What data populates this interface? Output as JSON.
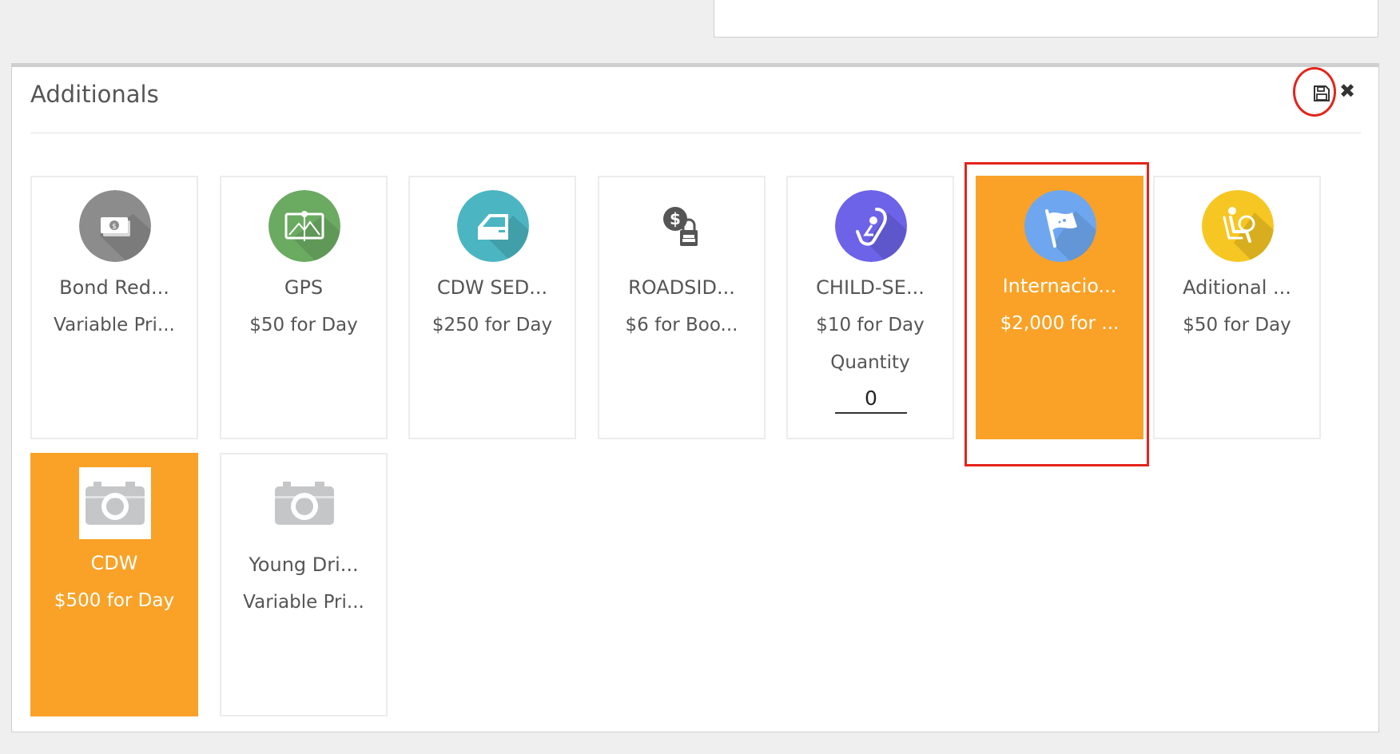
{
  "panel": {
    "title": "Additionals"
  },
  "toolbar": {
    "save_icon": "floppy-disk-icon",
    "close_icon": "close-x-icon",
    "close_glyph": "✖"
  },
  "cards": [
    {
      "name": "Bond Red...",
      "price": "Variable Pri...",
      "icon": "money-icon",
      "icon_color": "#8c8c8c",
      "selected": false
    },
    {
      "name": "GPS",
      "price": "$50 for Day",
      "icon": "map-icon",
      "icon_color": "#6aaa61",
      "selected": false
    },
    {
      "name": "CDW SED...",
      "price": "$250 for Day",
      "icon": "car-door-icon",
      "icon_color": "#4bb5c2",
      "selected": false
    },
    {
      "name": "ROADSID...",
      "price": "$6 for Boo...",
      "icon": "dollar-lock-icon",
      "icon_color": "#555555",
      "selected": false
    },
    {
      "name": "CHILD-SE...",
      "price": "$10 for Day",
      "icon": "child-seat-icon",
      "icon_color": "#6c63e8",
      "selected": false,
      "quantity_label": "Quantity",
      "quantity_value": "0"
    },
    {
      "name": "Internacio...",
      "price": "$2,000 for ...",
      "icon": "flag-icon",
      "icon_color": "#6ea7ef",
      "selected": true
    },
    {
      "name": "Aditional ...",
      "price": "$50 for Day",
      "icon": "driver-icon",
      "icon_color": "#f6c623",
      "selected": false
    },
    {
      "name": "CDW",
      "price": "$500 for Day",
      "icon": "camera-icon",
      "icon_color": "#c5c6c8",
      "selected": true
    },
    {
      "name": "Young Dri...",
      "price": "Variable Pri...",
      "icon": "camera-icon",
      "icon_color": "#c5c6c8",
      "selected": false
    }
  ],
  "annotations": {
    "highlight_color": "#e3241b"
  }
}
